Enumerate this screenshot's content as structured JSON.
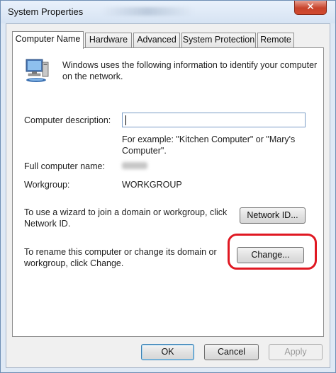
{
  "window": {
    "title": "System Properties"
  },
  "tabs": [
    {
      "label": "Computer Name",
      "active": true
    },
    {
      "label": "Hardware",
      "active": false
    },
    {
      "label": "Advanced",
      "active": false
    },
    {
      "label": "System Protection",
      "active": false
    },
    {
      "label": "Remote",
      "active": false
    }
  ],
  "intro": {
    "line1": "Windows uses the following information to identify your computer",
    "line2": "on the network."
  },
  "form": {
    "description_label": "Computer description:",
    "description_value": "",
    "example_line1": "For example: \"Kitchen Computer\" or \"Mary's",
    "example_line2": "Computer\".",
    "full_name_label": "Full computer name:",
    "workgroup_label": "Workgroup:",
    "workgroup_value": "WORKGROUP"
  },
  "network_id": {
    "text_line1": "To use a wizard to join a domain or workgroup, click",
    "text_line2": "Network ID.",
    "button_label": "Network ID..."
  },
  "change": {
    "text_line1": "To rename this computer or change its domain or",
    "text_line2": "workgroup, click Change.",
    "button_label": "Change..."
  },
  "footer": {
    "ok_label": "OK",
    "cancel_label": "Cancel",
    "apply_label": "Apply"
  },
  "colors": {
    "highlight": "#e01822",
    "close_button": "#c7432b",
    "frame": "#dfe9f5"
  },
  "icons": {
    "close": "close-icon",
    "computer": "computer-network-icon"
  }
}
